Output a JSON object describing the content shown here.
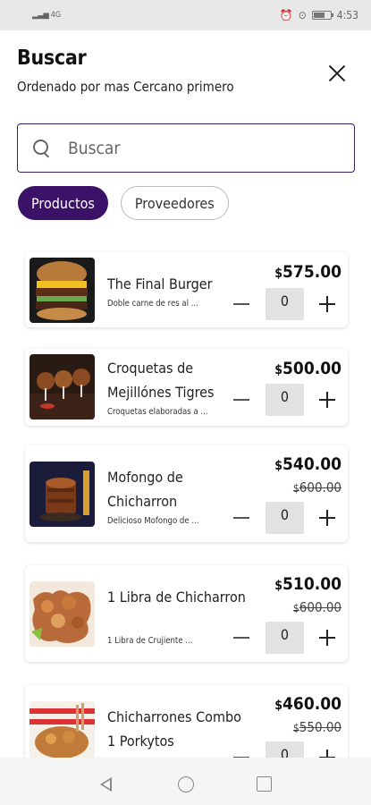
{
  "status_bar": {
    "signal": "4G",
    "time": "4:53"
  },
  "header": {
    "title": "Buscar",
    "subtitle": "Ordenado por mas Cercano primero"
  },
  "search": {
    "placeholder": "Buscar",
    "value": ""
  },
  "tabs": [
    {
      "label": "Productos",
      "active": true
    },
    {
      "label": "Proveedores",
      "active": false
    }
  ],
  "currency_symbol": "$",
  "products": [
    {
      "name": "The Final Burger",
      "description": "Doble carne de res al ...",
      "price": "575.00",
      "old_price": "",
      "quantity": "0"
    },
    {
      "name": "Croquetas de Mejillónes Tigres",
      "description": "Croquetas elaboradas a ...",
      "price": "500.00",
      "old_price": "",
      "quantity": "0"
    },
    {
      "name": "Mofongo de Chicharron",
      "description": "Delicioso Mofongo de ...",
      "price": "540.00",
      "old_price": "600.00",
      "quantity": "0"
    },
    {
      "name": "1 Libra de Chicharron",
      "description": "1 Libra de Crujiente ...",
      "price": "510.00",
      "old_price": "600.00",
      "quantity": "0"
    },
    {
      "name": "Chicharrones Combo 1 Porkytos",
      "description": "",
      "price": "460.00",
      "old_price": "550.00",
      "quantity": "0"
    }
  ],
  "icons": {
    "close": "close-icon",
    "search": "search-icon",
    "minus": "minus-icon",
    "plus": "plus-icon"
  },
  "colors": {
    "accent": "#3b1268"
  }
}
